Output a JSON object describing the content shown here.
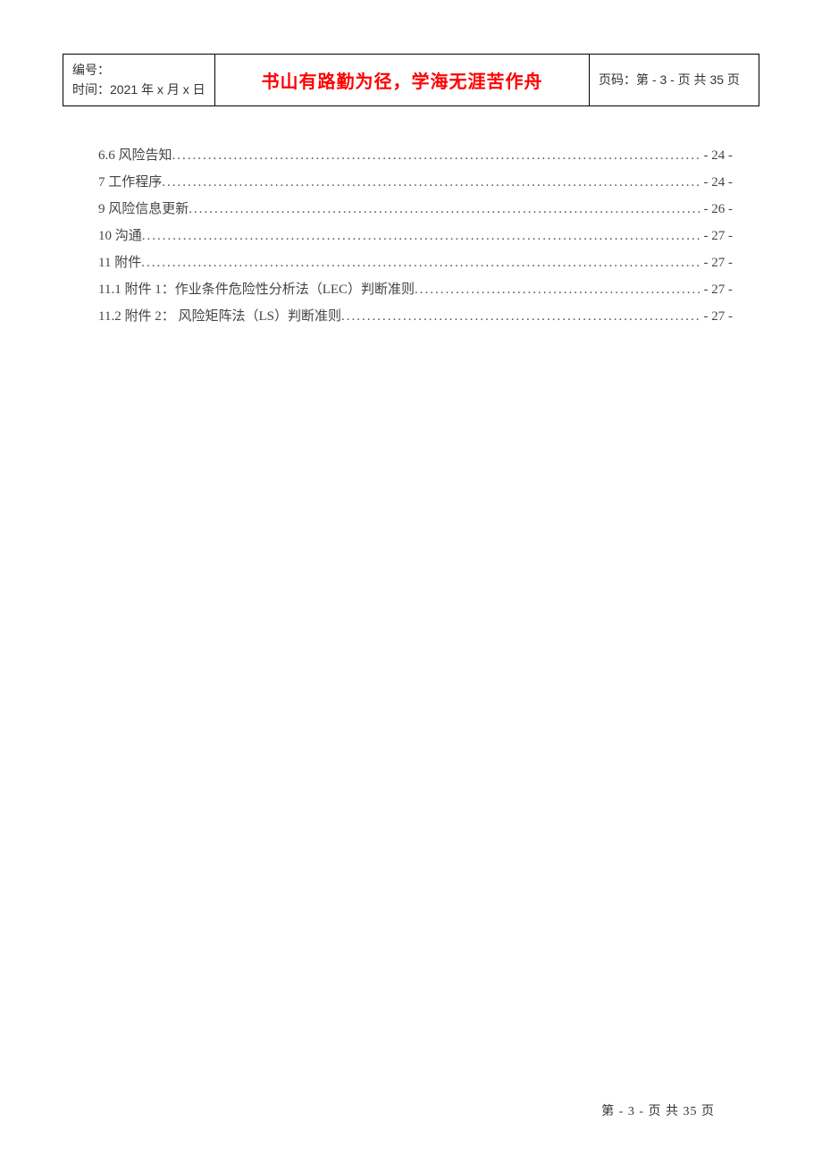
{
  "header": {
    "doc_no_label": "编号：",
    "time_label": "时间：2021 年 x 月 x 日",
    "center_motto": "书山有路勤为径，学海无涯苦作舟",
    "page_info": "页码：第 - 3 - 页  共 35 页"
  },
  "toc": [
    {
      "label": "6.6  风险告知",
      "page": "- 24 -"
    },
    {
      "label": "7  工作程序",
      "page": "- 24 -"
    },
    {
      "label": "9  风险信息更新",
      "page": "- 26 -"
    },
    {
      "label": "10  沟通",
      "page": "- 27 -"
    },
    {
      "label": "11  附件",
      "page": "- 27 -"
    },
    {
      "label": "11.1  附件 1：作业条件危险性分析法（LEC）判断准则 ",
      "page": "- 27 -"
    },
    {
      "label": "11.2  附件 2： 风险矩阵法（LS）判断准则 ",
      "page": "- 27 -"
    }
  ],
  "footer": "第 - 3 -  页 共  35  页"
}
